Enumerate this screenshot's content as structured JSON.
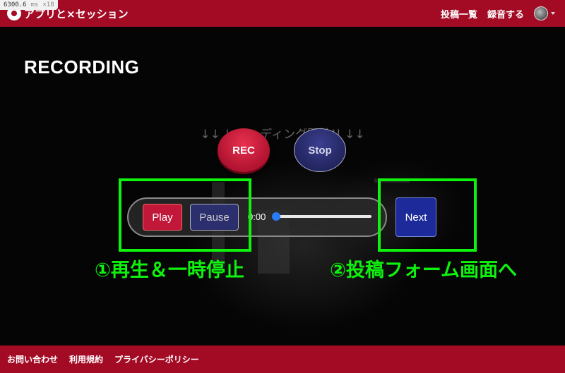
{
  "perf": {
    "value": "6300.6",
    "unit": "ms",
    "multiplier": "×18"
  },
  "header": {
    "brand": "アプリと×セッション",
    "nav": {
      "posts": "投稿一覧",
      "record": "録音する"
    }
  },
  "main": {
    "title": "RECORDING",
    "instruction": "↓↓ レコーディング開始!! ↓↓",
    "buttons": {
      "rec": "REC",
      "stop": "Stop",
      "play": "Play",
      "pause": "Pause",
      "next": "Next"
    },
    "player": {
      "time": "0:00",
      "progress": 0
    },
    "annotations": {
      "first": "①再生＆一時停止",
      "second": "②投稿フォーム画面へ"
    },
    "highlight_color": "#0ef20e"
  },
  "footer": {
    "links": [
      "お問い合わせ",
      "利用規約",
      "プライバシーポリシー"
    ]
  },
  "colors": {
    "brand": "#a30b25",
    "rec": "#c1183a",
    "stop": "#22255e",
    "next": "#1c2a9a",
    "seek": "#2a7cf6"
  }
}
